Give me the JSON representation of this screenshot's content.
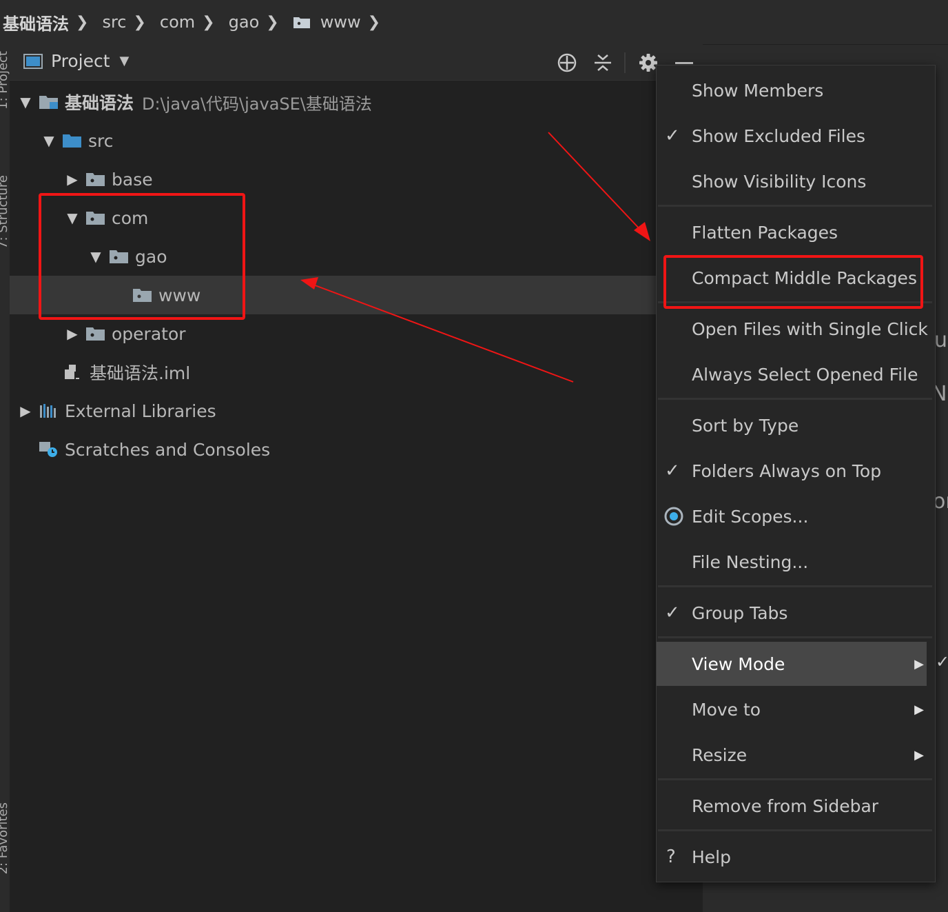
{
  "breadcrumb": {
    "items": [
      "基础语法",
      "src",
      "com",
      "gao",
      "www"
    ]
  },
  "side_tabs": {
    "top": "1: Project",
    "middle": "7: Structure",
    "bottom": "2: Favorites"
  },
  "panel": {
    "title": "Project",
    "icons": [
      "locate-icon",
      "collapse-all-icon",
      "gear-icon",
      "minimize-icon"
    ]
  },
  "tree": {
    "root": {
      "name": "基础语法",
      "path": "D:\\java\\代码\\javaSE\\基础语法"
    },
    "src": "src",
    "base": "base",
    "com": "com",
    "gao": "gao",
    "www": "www",
    "operator": "operator",
    "iml": "基础语法.iml",
    "external": "External Libraries",
    "scratches": "Scratches and Consoles"
  },
  "menu": {
    "show_members": "Show Members",
    "show_excluded": "Show Excluded Files",
    "show_visibility": "Show Visibility Icons",
    "flatten": "Flatten Packages",
    "compact": "Compact Middle Packages",
    "single_click": "Open Files with Single Click",
    "always_select": "Always Select Opened File",
    "sort_type": "Sort by Type",
    "folders_top": "Folders Always on Top",
    "edit_scopes": "Edit Scopes...",
    "file_nesting": "File Nesting...",
    "group_tabs": "Group Tabs",
    "view_mode": "View Mode",
    "move_to": "Move to",
    "resize": "Resize",
    "remove": "Remove from Sidebar",
    "help": "Help"
  },
  "checked": {
    "show_excluded": true,
    "folders_top": true,
    "group_tabs": true
  },
  "colors": {
    "annotation_red": "#f01515",
    "folder_icon": "#9aa7b0",
    "source_folder_blue": "#3d8ec9"
  }
}
